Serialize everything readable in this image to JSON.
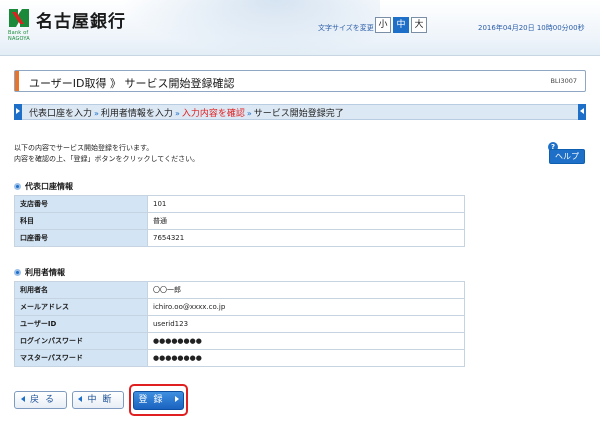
{
  "header": {
    "bank_name": "名古屋銀行",
    "logo_sub_line1": "Bank of",
    "logo_sub_line2": "NAGOYA",
    "font_size_label": "文字サイズを変更",
    "font_sizes": [
      "小",
      "中",
      "大"
    ],
    "font_size_selected": "中",
    "datetime": "2016年04月20日 10時00分00秒"
  },
  "page": {
    "title": "ユーザーID取得 》 サービス開始登録確認",
    "screen_code": "BLI3007"
  },
  "steps": {
    "items": [
      "代表口座を入力",
      "利用者情報を入力",
      "入力内容を確認",
      "サービス開始登録完了"
    ],
    "current_index": 2,
    "separator": "»"
  },
  "intro": {
    "line1": "以下の内容でサービス開始登録を行います。",
    "line2": "内容を確認の上、「登録」ボタンをクリックしてください。"
  },
  "help": {
    "icon": "?",
    "label": "ヘルプ"
  },
  "account_section": {
    "heading": "代表口座情報",
    "rows": [
      {
        "label": "支店番号",
        "value": "101"
      },
      {
        "label": "科目",
        "value": "普通"
      },
      {
        "label": "口座番号",
        "value": "7654321"
      }
    ]
  },
  "user_section": {
    "heading": "利用者情報",
    "rows": [
      {
        "label": "利用者名",
        "value": "〇〇一郎"
      },
      {
        "label": "メールアドレス",
        "value": "ichiro.oo@xxxx.co.jp"
      },
      {
        "label": "ユーザーID",
        "value": "userid123"
      },
      {
        "label": "ログインパスワード",
        "value": "●●●●●●●●"
      },
      {
        "label": "マスターパスワード",
        "value": "●●●●●●●●"
      }
    ]
  },
  "buttons": {
    "back": "戻る",
    "suspend": "中断",
    "register": "登録"
  },
  "colors": {
    "accent_blue": "#1e6fc8",
    "highlight_red": "#e02020",
    "table_header": "#d3e4f4",
    "title_accent": "#e8732a"
  }
}
